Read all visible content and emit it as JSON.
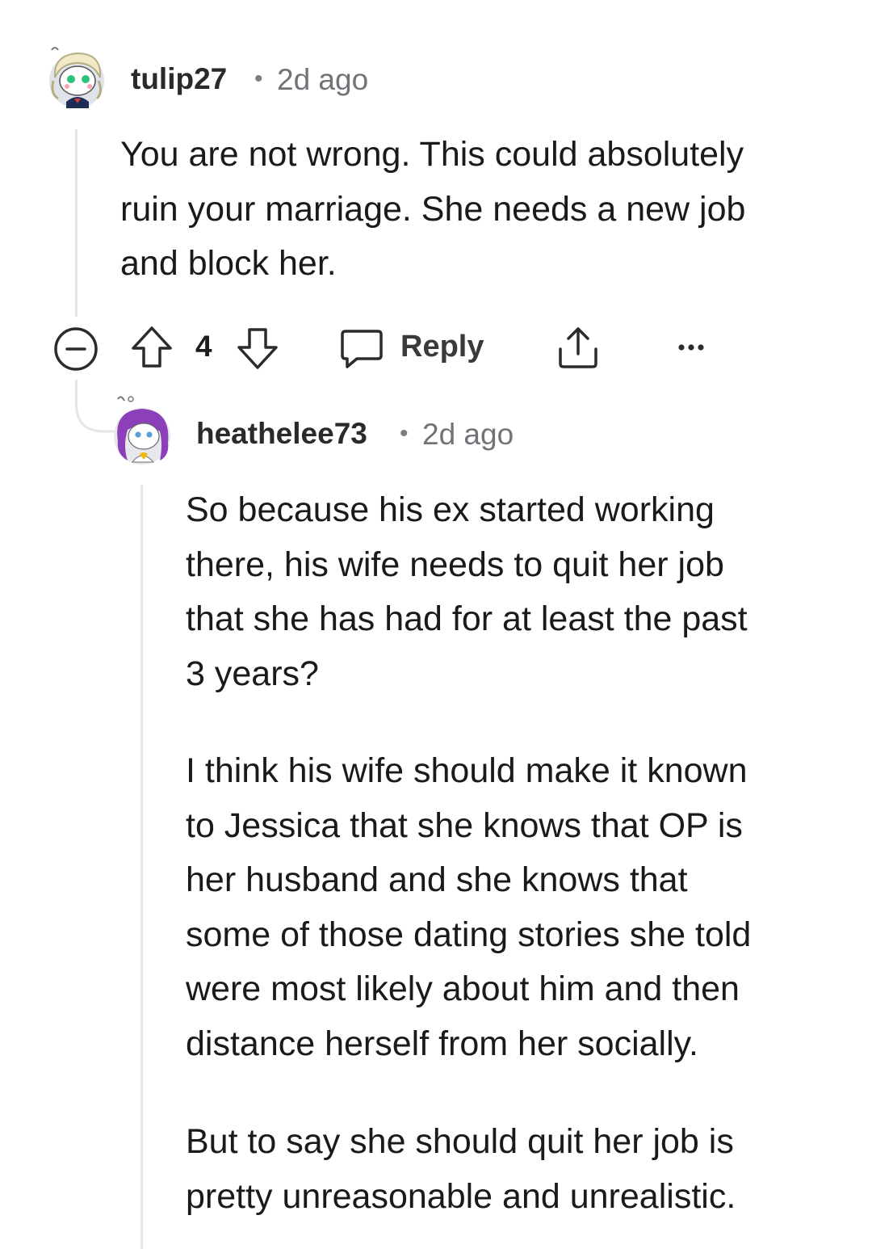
{
  "comment1": {
    "username": "tulip27",
    "separator": "•",
    "time": "2d ago",
    "body": "You are not wrong. This could absolutely\nruin your marriage. She needs a new job\nand block her.",
    "votes": "4",
    "reply_label": "Reply",
    "avatar_icon": "avatar-tulip27-icon"
  },
  "comment2": {
    "username": "heathelee73",
    "separator": "•",
    "time": "2d ago",
    "paragraph1": "So because his ex started working\nthere, his wife needs to quit her job\nthat she has had for at least the past\n3 years?",
    "paragraph2": "I think his wife should make it known\nto Jessica that she knows that OP is\nher husband and she knows that\nsome of those dating stories she told\nwere most likely about him and then\ndistance herself from her socially.",
    "paragraph3": "But to say she should quit her job is\npretty unreasonable and unrealistic.",
    "avatar_icon": "avatar-heathelee73-icon"
  },
  "colors": {
    "text": "#1a1a1b",
    "meta": "#707478",
    "thread_line": "#e4e6e8"
  }
}
